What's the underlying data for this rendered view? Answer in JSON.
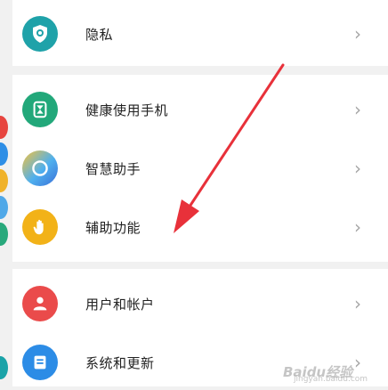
{
  "settings": {
    "items": [
      {
        "label": "隐私",
        "icon": "privacy-shield-icon",
        "color": "#1fa2a9"
      },
      {
        "label": "健康使用手机",
        "icon": "hourglass-icon",
        "color": "#22a87a"
      },
      {
        "label": "智慧助手",
        "icon": "smart-assistant-icon",
        "color": "#4d8fe0"
      },
      {
        "label": "辅助功能",
        "icon": "hand-icon",
        "color": "#f2b218"
      },
      {
        "label": "用户和帐户",
        "icon": "user-icon",
        "color": "#ea4b4b"
      },
      {
        "label": "系统和更新",
        "icon": "system-update-icon",
        "color": "#2c8ce6"
      }
    ],
    "chevron": "›"
  },
  "annotation": {
    "arrow_color": "#e8313a"
  },
  "watermark": {
    "text": "Baidu经验",
    "sub": "jingyan.baidu.com"
  }
}
